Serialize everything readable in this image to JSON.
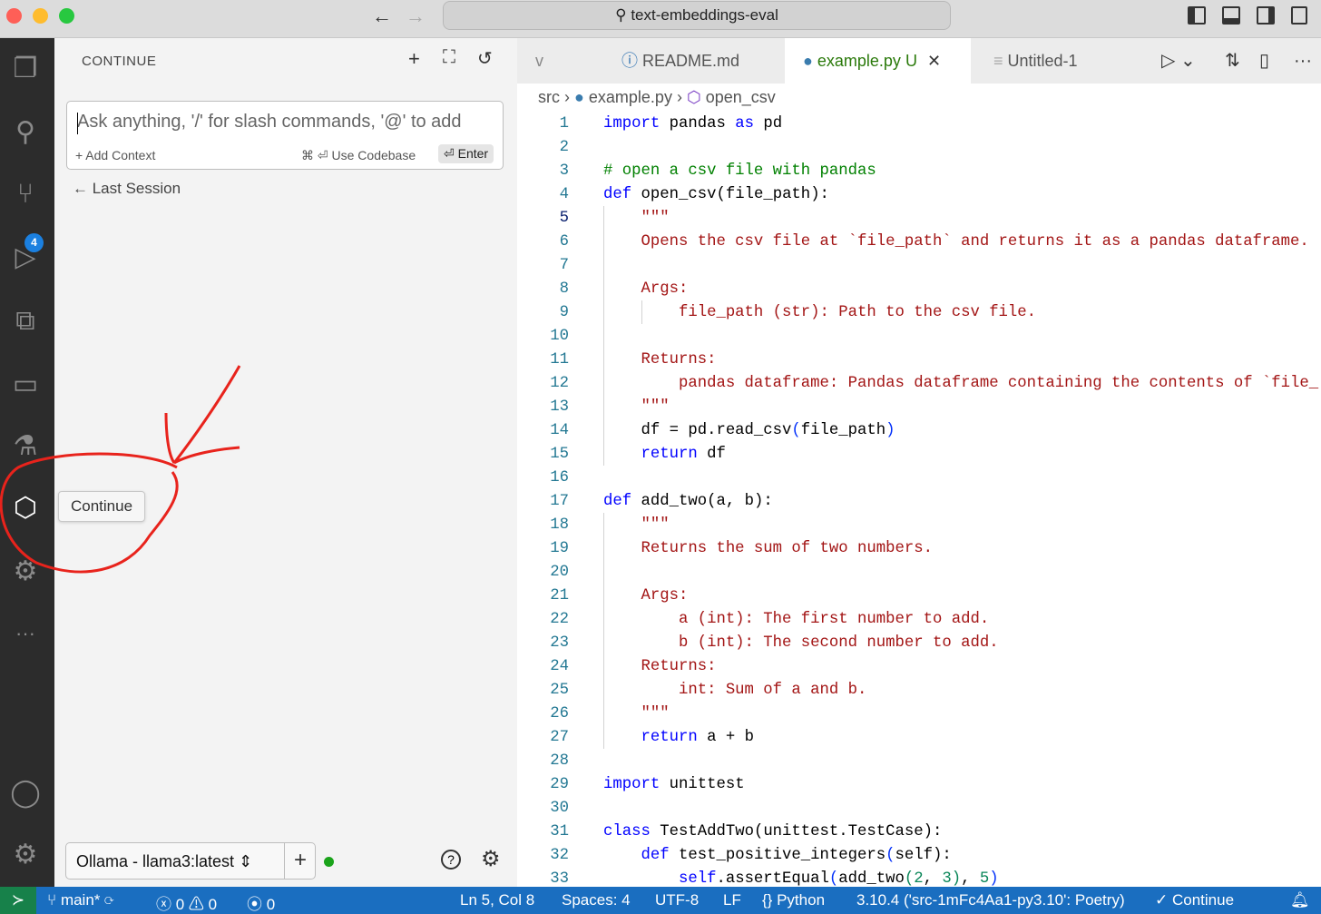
{
  "window": {
    "title": "text-embeddings-eval"
  },
  "sidebar": {
    "title": "CONTINUE",
    "input_placeholder": "Ask anything, '/' for slash commands, '@' to add",
    "add_context": "+ Add Context",
    "use_codebase": "⌘ ⏎ Use Codebase",
    "enter": "⏎ Enter",
    "last_session": "← Last Session",
    "model": "Ollama - llama3:latest",
    "tooltip": "Continue",
    "git_badge": "4"
  },
  "tabs": [
    {
      "label": "README.md"
    },
    {
      "label": "example.py",
      "status": "U"
    },
    {
      "label": "Untitled-1"
    }
  ],
  "breadcrumb": [
    "src",
    "example.py",
    "open_csv"
  ],
  "code": {
    "current_line": 5,
    "lines": [
      [
        [
          "import",
          "kw"
        ],
        [
          " pandas ",
          "pl"
        ],
        [
          "as",
          "kw"
        ],
        [
          " pd",
          "pl"
        ]
      ],
      [],
      [
        [
          "# open a csv file with pandas",
          "cm"
        ]
      ],
      [
        [
          "def",
          "kw"
        ],
        [
          " open_csv",
          "pl"
        ],
        [
          "(",
          "pl"
        ],
        [
          "file_path",
          "pl"
        ],
        [
          "):",
          "pl"
        ]
      ],
      [
        [
          "    \"\"\"",
          "st"
        ]
      ],
      [
        [
          "    Opens the csv file at `file_path` and returns it as a pandas dataframe.",
          "st"
        ]
      ],
      [],
      [
        [
          "    Args:",
          "st"
        ]
      ],
      [
        [
          "        file_path (str): Path to the csv file.",
          "st"
        ]
      ],
      [],
      [
        [
          "    Returns:",
          "st"
        ]
      ],
      [
        [
          "        pandas dataframe: Pandas dataframe containing the contents of `file_",
          "st"
        ]
      ],
      [
        [
          "    \"\"\"",
          "st"
        ]
      ],
      [
        [
          "    df = pd.read_csv",
          "pl"
        ],
        [
          "(",
          "br"
        ],
        [
          "file_path",
          "pl"
        ],
        [
          ")",
          "br"
        ]
      ],
      [
        [
          "    ",
          "pl"
        ],
        [
          "return",
          "kw"
        ],
        [
          " df",
          "pl"
        ]
      ],
      [],
      [
        [
          "def",
          "kw"
        ],
        [
          " add_two",
          "pl"
        ],
        [
          "(",
          "pl"
        ],
        [
          "a, b",
          "pl"
        ],
        [
          "):",
          "pl"
        ]
      ],
      [
        [
          "    \"\"\"",
          "st"
        ]
      ],
      [
        [
          "    Returns the sum of two numbers.",
          "st"
        ]
      ],
      [],
      [
        [
          "    Args:",
          "st"
        ]
      ],
      [
        [
          "        a (int): The first number to add.",
          "st"
        ]
      ],
      [
        [
          "        b (int): The second number to add.",
          "st"
        ]
      ],
      [
        [
          "    Returns:",
          "st"
        ]
      ],
      [
        [
          "        int: Sum of a and b.",
          "st"
        ]
      ],
      [
        [
          "    \"\"\"",
          "st"
        ]
      ],
      [
        [
          "    ",
          "pl"
        ],
        [
          "return",
          "kw"
        ],
        [
          " a + b",
          "pl"
        ]
      ],
      [],
      [
        [
          "import",
          "kw"
        ],
        [
          " unittest",
          "pl"
        ]
      ],
      [],
      [
        [
          "class",
          "kw"
        ],
        [
          " TestAddTwo",
          "pl"
        ],
        [
          "(",
          "pl"
        ],
        [
          "unittest.TestCase",
          "pl"
        ],
        [
          "):",
          "pl"
        ]
      ],
      [
        [
          "    ",
          "pl"
        ],
        [
          "def",
          "kw"
        ],
        [
          " test_positive_integers",
          "pl"
        ],
        [
          "(",
          "br"
        ],
        [
          "self",
          "pl"
        ],
        [
          "):",
          "pl"
        ]
      ],
      [
        [
          "        ",
          "pl"
        ],
        [
          "self",
          "kw"
        ],
        [
          ".assertEqual",
          "pl"
        ],
        [
          "(",
          "br"
        ],
        [
          "add_two",
          "pl"
        ],
        [
          "(",
          "nm"
        ],
        [
          "2",
          "nm"
        ],
        [
          ", ",
          "pl"
        ],
        [
          "3",
          "nm"
        ],
        [
          ")",
          "nm"
        ],
        [
          ", ",
          "pl"
        ],
        [
          "5",
          "nm"
        ],
        [
          ")",
          "br"
        ]
      ]
    ]
  },
  "status": {
    "branch": "main*",
    "errors": "0",
    "warnings": "0",
    "ports": "0",
    "position": "Ln 5, Col 8",
    "spaces": "Spaces: 4",
    "encoding": "UTF-8",
    "eol": "LF",
    "language": "Python",
    "interpreter": "3.10.4 ('src-1mFc4Aa1-py3.10': Poetry)",
    "continue": "✓ Continue"
  }
}
